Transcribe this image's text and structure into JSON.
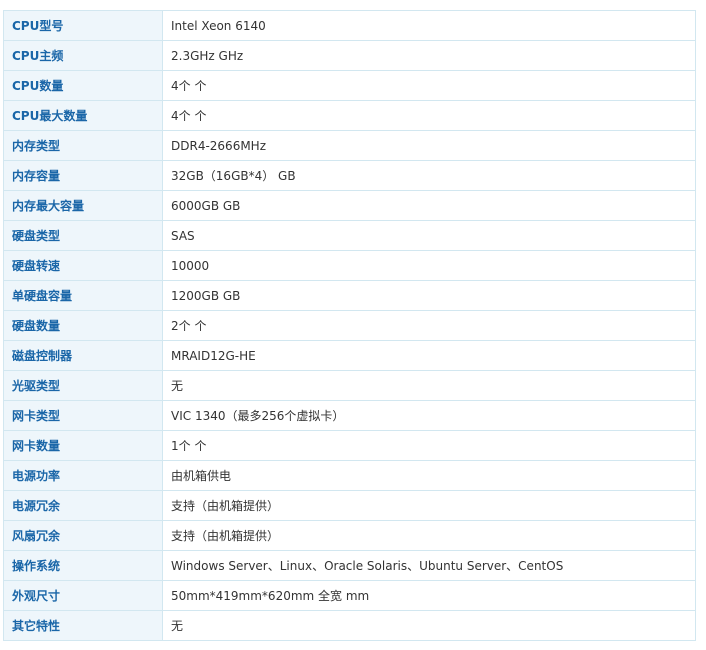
{
  "specs": [
    {
      "label": "CPU型号",
      "value": "Intel Xeon 6140"
    },
    {
      "label": "CPU主频",
      "value": "2.3GHz  GHz"
    },
    {
      "label": "CPU数量",
      "value": "4个  个"
    },
    {
      "label": "CPU最大数量",
      "value": "4个  个"
    },
    {
      "label": "内存类型",
      "value": "DDR4-2666MHz"
    },
    {
      "label": "内存容量",
      "value": "32GB（16GB*4）  GB"
    },
    {
      "label": "内存最大容量",
      "value": "6000GB  GB"
    },
    {
      "label": "硬盘类型",
      "value": "SAS"
    },
    {
      "label": "硬盘转速",
      "value": "10000"
    },
    {
      "label": "单硬盘容量",
      "value": "1200GB  GB"
    },
    {
      "label": "硬盘数量",
      "value": "2个  个"
    },
    {
      "label": "磁盘控制器",
      "value": "MRAID12G-HE"
    },
    {
      "label": "光驱类型",
      "value": "无"
    },
    {
      "label": "网卡类型",
      "value": "VIC 1340（最多256个虚拟卡）"
    },
    {
      "label": "网卡数量",
      "value": "1个  个"
    },
    {
      "label": "电源功率",
      "value": "由机箱供电"
    },
    {
      "label": "电源冗余",
      "value": "支持（由机箱提供）"
    },
    {
      "label": "风扇冗余",
      "value": "支持（由机箱提供）"
    },
    {
      "label": "操作系统",
      "value": "Windows Server、Linux、Oracle Solaris、Ubuntu Server、CentOS"
    },
    {
      "label": "外观尺寸",
      "value": "50mm*419mm*620mm 全宽  mm"
    },
    {
      "label": "其它特性",
      "value": "无"
    }
  ]
}
